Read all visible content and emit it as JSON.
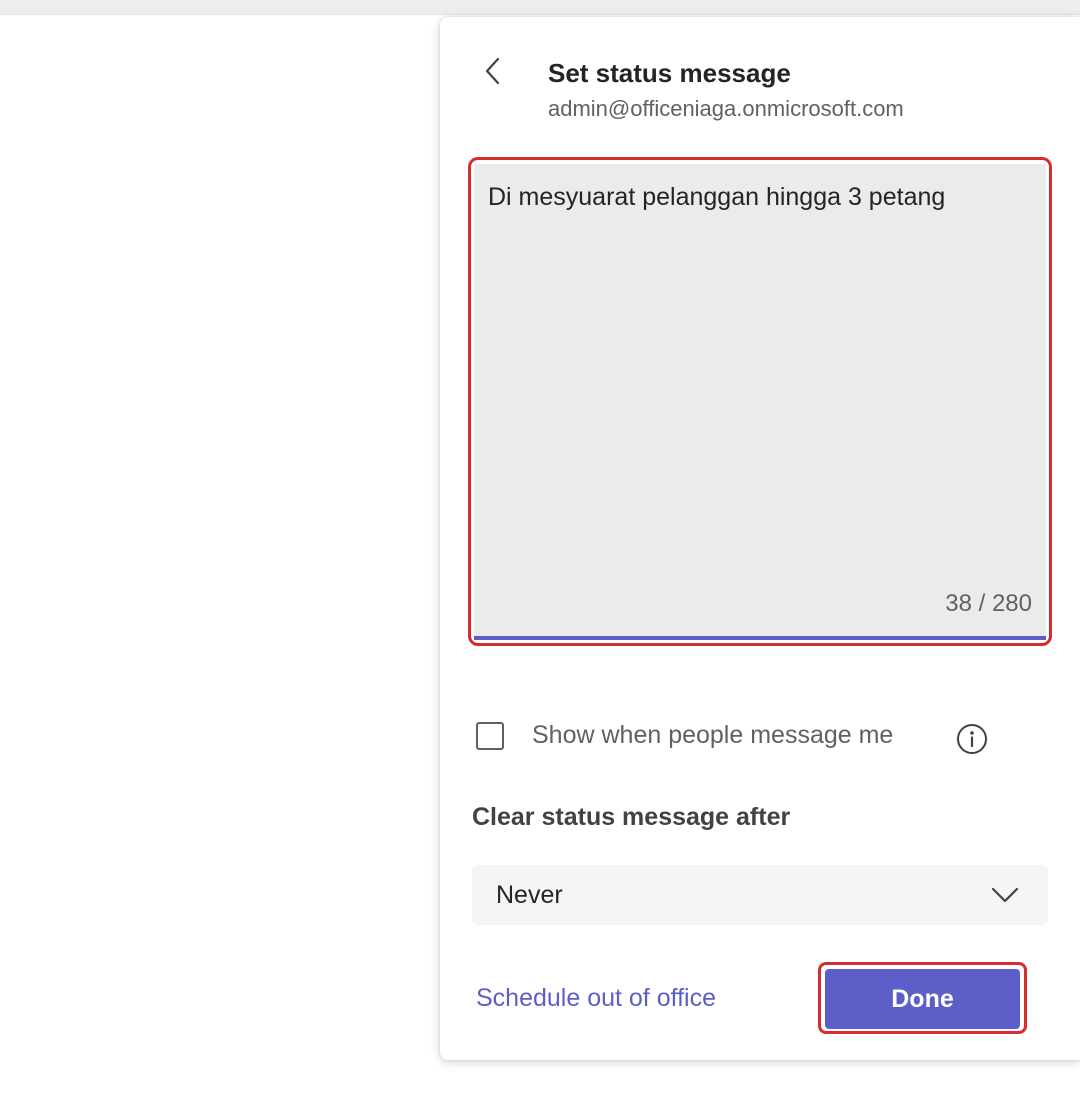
{
  "panel": {
    "title": "Set status message",
    "account": "admin@officeniaga.onmicrosoft.com",
    "back_icon": "chevron-left-icon"
  },
  "message": {
    "value": "Di mesyuarat pelanggan hingga 3 petang",
    "counter": "38 / 280",
    "length": 38,
    "max_length": 280
  },
  "show_when_messaged": {
    "label": "Show when people message me",
    "checked": false,
    "info_icon": "info-icon"
  },
  "clear_after": {
    "label": "Clear status message after",
    "selected": "Never",
    "icon": "chevron-down-icon"
  },
  "footer": {
    "schedule_link": "Schedule out of office",
    "done_label": "Done"
  },
  "colors": {
    "accent": "#5b5fc7",
    "highlight": "#d32f2f",
    "text_field_bg": "#ebebeb"
  }
}
